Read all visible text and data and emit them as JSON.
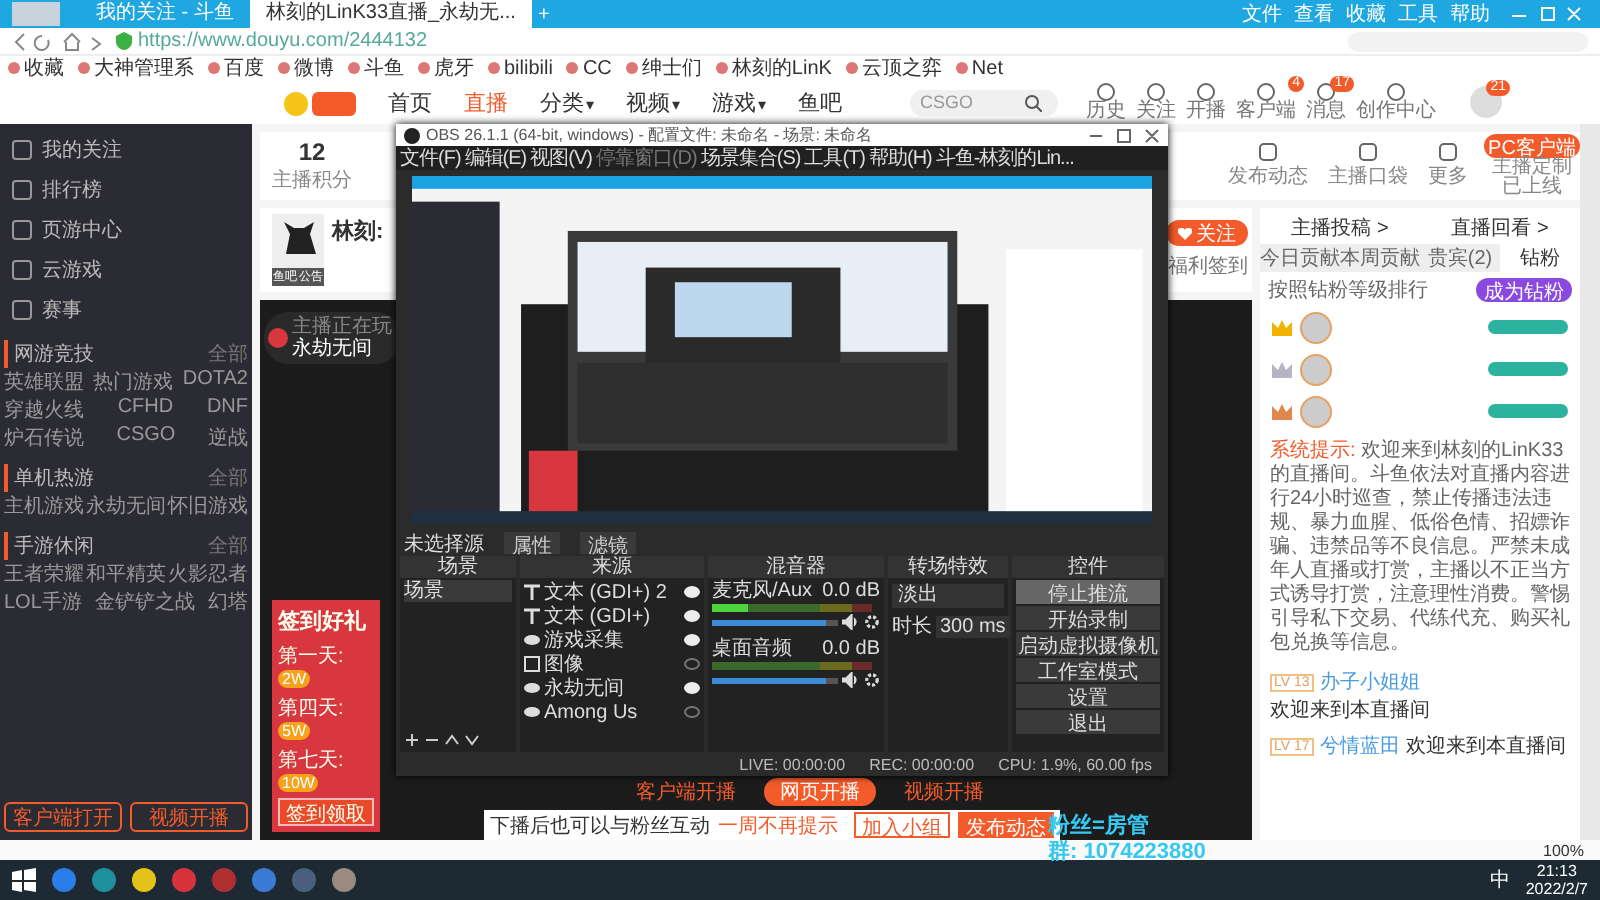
{
  "browser": {
    "tabs": [
      {
        "title": "我的关注 - 斗鱼",
        "selected": false
      },
      {
        "title": "林刻的LinK33直播_永劫无...",
        "selected": true
      }
    ],
    "new_tab": "+",
    "menu": [
      "文件",
      "查看",
      "收藏",
      "工具",
      "帮助"
    ],
    "url": "https://www.douyu.com/2444132",
    "bookmarks": [
      "收藏",
      "大神管理系",
      "百度",
      "微博",
      "斗鱼",
      "虎牙",
      "bilibili",
      "CC",
      "绅士们",
      "林刻的LinK",
      "云顶之弈",
      "Net"
    ],
    "zoom": "100%"
  },
  "site": {
    "nav": [
      {
        "label": "首页",
        "selected": false
      },
      {
        "label": "直播",
        "selected": true
      },
      {
        "label": "分类",
        "selected": false,
        "caret": "▾"
      },
      {
        "label": "视频",
        "selected": false,
        "caret": "▾"
      },
      {
        "label": "游戏",
        "selected": false,
        "caret": "▾"
      },
      {
        "label": "鱼吧",
        "selected": false
      }
    ],
    "search": {
      "value": "CSGO"
    },
    "header_icons": [
      {
        "label": "历史"
      },
      {
        "label": "关注"
      },
      {
        "label": "开播"
      },
      {
        "label": "客户端",
        "badge": "4"
      },
      {
        "label": "消息",
        "badge": "17"
      },
      {
        "label": "创作中心"
      }
    ],
    "avatar_badge": "21"
  },
  "sidebar": {
    "nav": [
      "我的关注",
      "排行榜",
      "页游中心",
      "云游戏",
      "赛事"
    ],
    "sections": [
      {
        "title": "网游竞技",
        "more": "全部",
        "rows": [
          [
            "英雄联盟",
            "热门游戏",
            "DOTA2"
          ],
          [
            "穿越火线",
            "CFHD",
            "DNF"
          ],
          [
            "炉石传说",
            "CSGO",
            "逆战"
          ]
        ]
      },
      {
        "title": "单机热游",
        "more": "全部",
        "rows": [
          [
            "主机游戏",
            "永劫无间",
            "怀旧游戏"
          ]
        ]
      },
      {
        "title": "手游休闲",
        "more": "全部",
        "rows": [
          [
            "王者荣耀",
            "和平精英",
            "火影忍者"
          ],
          [
            "LOL手游",
            "金铲铲之战",
            "幻塔"
          ]
        ]
      }
    ],
    "buttons": [
      "客户端打开",
      "视频开播"
    ]
  },
  "studio": {
    "stat_value": "12",
    "stat_label": "主播积分",
    "actions": [
      "发布动态",
      "主播口袋",
      "更多"
    ],
    "pc_client": "PC客户端",
    "pc_note": "主播定制已上线"
  },
  "streamer": {
    "name": "林刻:",
    "links": [
      "鱼吧",
      "公告"
    ],
    "follow": "关注",
    "checkin": "福利签到"
  },
  "video": {
    "now_playing": {
      "label": "主播正在玩",
      "game": "永劫无间"
    },
    "promo": {
      "title": "签到好礼",
      "days": [
        {
          "label": "第一天:",
          "reward": "2W"
        },
        {
          "label": "第四天:",
          "reward": "5W"
        },
        {
          "label": "第七天:",
          "reward": "10W"
        }
      ],
      "button": "签到领取"
    },
    "overlay": [
      "粉丝=房管",
      "群: 1074223880"
    ],
    "stream_modes": [
      {
        "label": "客户端开播",
        "selected": false
      },
      {
        "label": "网页开播",
        "selected": true
      },
      {
        "label": "视频开播",
        "selected": false
      }
    ],
    "popup": {
      "text": "下播后也可以与粉丝互动",
      "dismiss": "一周不再提示",
      "buttons": [
        {
          "label": "加入小组",
          "kind": "outline"
        },
        {
          "label": "发布动态",
          "kind": "filled"
        }
      ]
    }
  },
  "chat": {
    "links": [
      "主播投稿 >",
      "直播回看 >"
    ],
    "tabs": [
      {
        "label": "今日贡献",
        "selected": false
      },
      {
        "label": "本周贡献",
        "selected": false
      },
      {
        "label": "贵宾(2)",
        "selected": false
      },
      {
        "label": "钻粉",
        "selected": true
      }
    ],
    "ranking_title": "按照钻粉等级排行",
    "join": "成为钻粉",
    "fans": [
      {
        "color": "#f2b200"
      },
      {
        "color": "#b4b4c4"
      },
      {
        "color": "#e0874e"
      }
    ],
    "system": {
      "label": "系统提示:",
      "text": "欢迎来到林刻的LinK33的直播间。斗鱼依法对直播内容进行24小时巡查，禁止传播违法违规、暴力血腥、低俗色情、招嫖诈骗、违禁品等不良信息。严禁未成年人直播或打赏，主播以不正当方式诱导打赏，注意理性消费。警惕引导私下交易、代练代充、购买礼包兑换等信息。"
    },
    "welcomes": [
      {
        "level": "LV 13",
        "name": "办子小姐姐",
        "text": "欢迎来到本直播间"
      },
      {
        "level": "LV 17",
        "name": "兮情蓝田",
        "text": "欢迎来到本直播间"
      }
    ]
  },
  "obs": {
    "title": "OBS 26.1.1 (64-bit, windows) - 配置文件: 未命名 - 场景: 未命名",
    "menu": [
      {
        "label": "文件(F)",
        "disabled": false
      },
      {
        "label": "编辑(E)",
        "disabled": false
      },
      {
        "label": "视图(V)",
        "disabled": false
      },
      {
        "label": "停靠窗口(D)",
        "disabled": true
      },
      {
        "label": "场景集合(S)",
        "disabled": false
      },
      {
        "label": "工具(T)",
        "disabled": false
      },
      {
        "label": "帮助(H)",
        "disabled": false
      },
      {
        "label": "斗鱼-林刻的Lin...",
        "disabled": false
      }
    ],
    "no_source": "未选择源",
    "source_tabs": [
      "属性",
      "滤镜"
    ],
    "docks": [
      "场景",
      "来源",
      "混音器",
      "转场特效",
      "控件"
    ],
    "scenes": [
      {
        "name": "场景",
        "selected": true
      }
    ],
    "sources": [
      {
        "name": "文本 (GDI+) 2",
        "kind": "text",
        "visible": true
      },
      {
        "name": "文本 (GDI+)",
        "kind": "text",
        "visible": true
      },
      {
        "name": "游戏采集",
        "kind": "game",
        "visible": true
      },
      {
        "name": "图像",
        "kind": "image",
        "visible": false
      },
      {
        "name": "永劫无间",
        "kind": "game",
        "visible": true
      },
      {
        "name": "Among Us",
        "kind": "game",
        "visible": false
      }
    ],
    "mixer": [
      {
        "name": "麦克风/Aux",
        "reading": "0.0 dB",
        "level": 0.9
      },
      {
        "name": "桌面音频",
        "reading": "0.0 dB",
        "level": 0.9
      }
    ],
    "transition": {
      "value": "淡出",
      "duration_label": "时长",
      "duration": "300 ms"
    },
    "controls": [
      {
        "label": "停止推流",
        "selected": true
      },
      {
        "label": "开始录制",
        "selected": false
      },
      {
        "label": "启动虚拟摄像机",
        "selected": false
      },
      {
        "label": "工作室模式",
        "selected": false
      },
      {
        "label": "设置",
        "selected": false
      },
      {
        "label": "退出",
        "selected": false
      }
    ],
    "status": [
      "LIVE: 00:00:00",
      "REC: 00:00:00",
      "CPU: 1.9%, 60.00 fps"
    ]
  },
  "taskbar": {
    "ime": "中",
    "time": "21:13",
    "date": "2022/2/7"
  }
}
